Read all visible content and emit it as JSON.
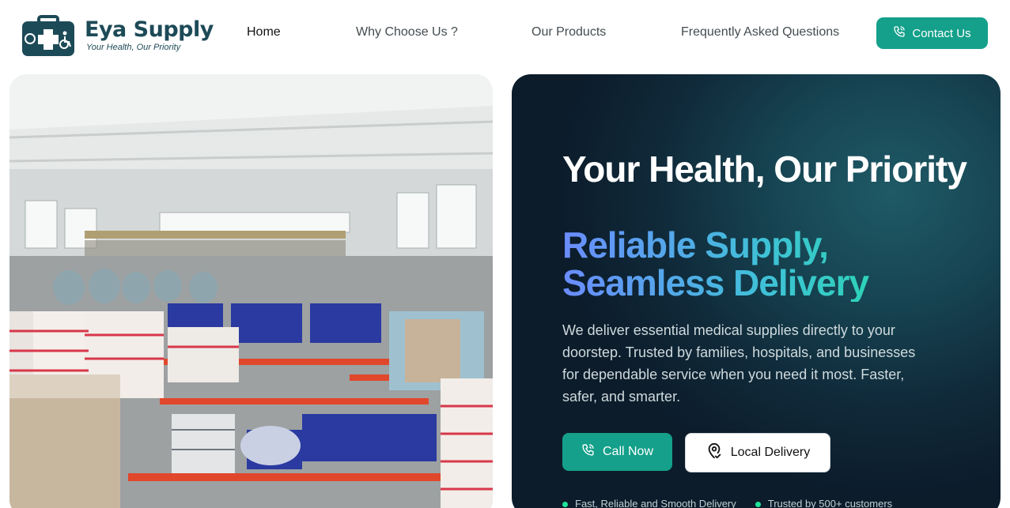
{
  "header": {
    "brand": "Eya Supply",
    "tagline": "Your Health, Our Priority",
    "logo_icon": "medical-kit-icon",
    "nav": [
      {
        "label": "Home",
        "active": true
      },
      {
        "label": "Why Choose Us ?",
        "active": false
      },
      {
        "label": "Our Products",
        "active": false
      },
      {
        "label": "Frequently Asked Questions",
        "active": false
      }
    ],
    "contact_label": "Contact Us",
    "contact_icon": "phone-icon"
  },
  "hero": {
    "title": "Your Health, Our Priority",
    "subtitle": "Reliable Supply, Seamless Delivery",
    "description": "We deliver essential medical supplies directly to your doorstep. Trusted by families, hospitals, and businesses for dependable service when you need it most. Faster, safer, and smarter.",
    "call_label": "Call Now",
    "call_icon": "phone-icon",
    "local_label": "Local Delivery",
    "local_icon": "location-pin-icon",
    "features": [
      "Fast, Reliable and Smooth Delivery",
      "Trusted by 500+ customers"
    ]
  },
  "image": {
    "subject": "warehouse-photo"
  },
  "colors": {
    "accent": "#14a08a",
    "brand": "#1d4a57",
    "hero_bg": "#102a3a",
    "gradient_start": "#6b8cff",
    "gradient_end": "#1ee49a"
  }
}
